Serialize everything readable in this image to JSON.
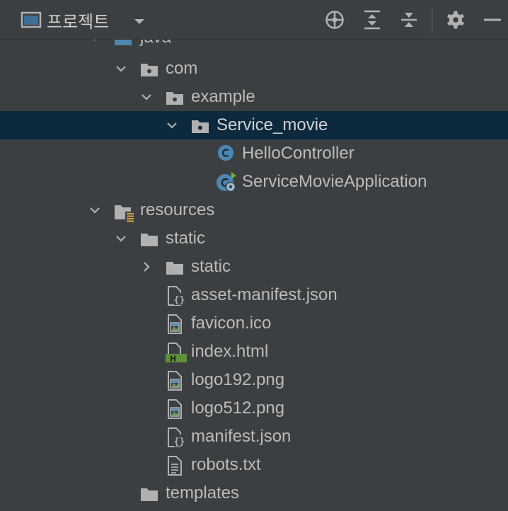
{
  "toolbar": {
    "view_label": "프로젝트",
    "icons": [
      "window-icon",
      "dropdown-icon",
      "locate-icon",
      "expand-all-icon",
      "collapse-all-icon",
      "gear-icon",
      "minimize-icon"
    ]
  },
  "tree": {
    "nodes": [
      {
        "label": "java",
        "icon": "source-folder-icon",
        "expanded": true
      },
      {
        "label": "com",
        "icon": "package-icon",
        "expanded": true
      },
      {
        "label": "example",
        "icon": "package-icon",
        "expanded": true
      },
      {
        "label": "Service_movie",
        "icon": "package-icon",
        "expanded": true,
        "selected": true
      },
      {
        "label": "HelloController",
        "icon": "java-class-icon"
      },
      {
        "label": "ServiceMovieApplication",
        "icon": "spring-boot-class-icon"
      },
      {
        "label": "resources",
        "icon": "resources-folder-icon",
        "expanded": true
      },
      {
        "label": "static",
        "icon": "folder-icon",
        "expanded": true
      },
      {
        "label": "static",
        "icon": "folder-icon",
        "expanded": false
      },
      {
        "label": "asset-manifest.json",
        "icon": "json-file-icon"
      },
      {
        "label": "favicon.ico",
        "icon": "image-file-icon"
      },
      {
        "label": "index.html",
        "icon": "html-file-icon"
      },
      {
        "label": "logo192.png",
        "icon": "image-file-icon"
      },
      {
        "label": "logo512.png",
        "icon": "image-file-icon"
      },
      {
        "label": "manifest.json",
        "icon": "json-file-icon"
      },
      {
        "label": "robots.txt",
        "icon": "text-file-icon"
      },
      {
        "label": "templates",
        "icon": "folder-icon"
      }
    ]
  },
  "colors": {
    "background": "#3c3f41",
    "selection": "#0d293e",
    "text": "#bbbbbb",
    "class_icon": "#4b87b3",
    "html_icon": "#5f8f3c",
    "spring_green": "#6cb33e"
  }
}
